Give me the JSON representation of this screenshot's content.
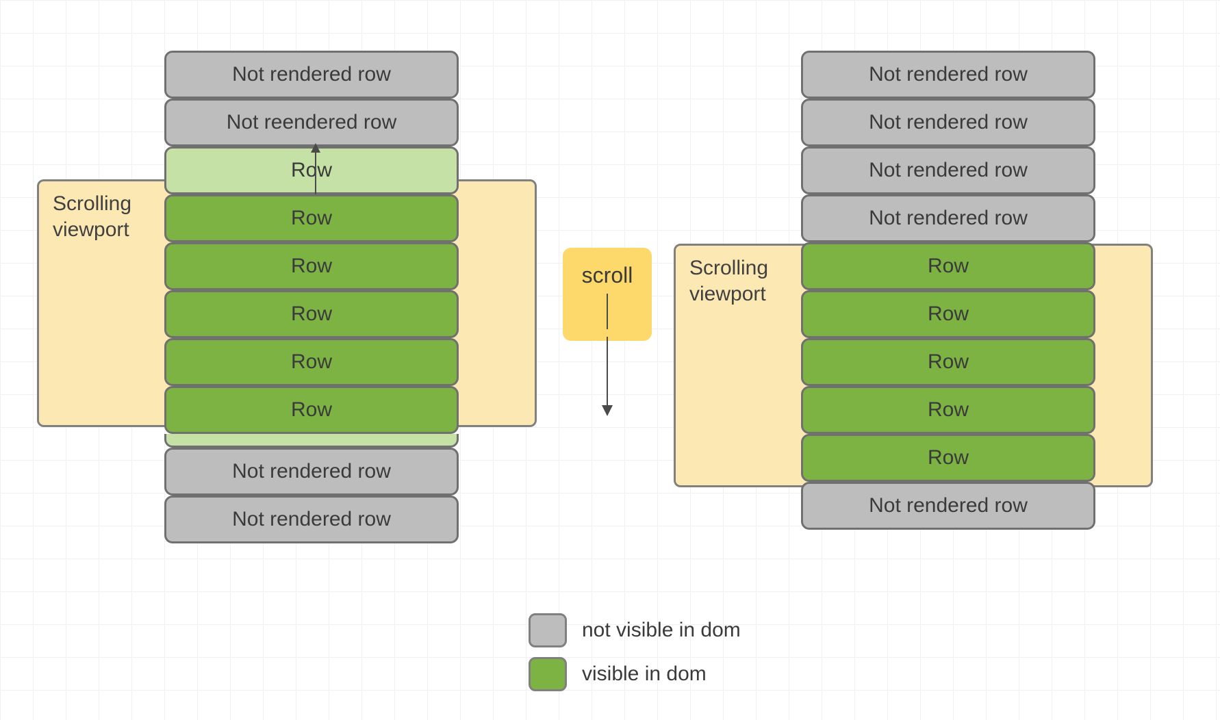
{
  "left": {
    "viewport_label": "Scrolling\nviewport",
    "rows": [
      {
        "label": "Not rendered row",
        "kind": "gray"
      },
      {
        "label": "Not reendered row",
        "kind": "gray"
      },
      {
        "label": "Row",
        "kind": "light"
      },
      {
        "label": "Row",
        "kind": "green"
      },
      {
        "label": "Row",
        "kind": "green"
      },
      {
        "label": "Row",
        "kind": "green"
      },
      {
        "label": "Row",
        "kind": "green"
      },
      {
        "label": "Row",
        "kind": "green"
      },
      {
        "label": "",
        "kind": "strip"
      },
      {
        "label": "Not rendered row",
        "kind": "gray"
      },
      {
        "label": "Not rendered row",
        "kind": "gray"
      }
    ]
  },
  "right": {
    "viewport_label": "Scrolling\nviewport",
    "rows": [
      {
        "label": "Not rendered row",
        "kind": "gray"
      },
      {
        "label": "Not rendered row",
        "kind": "gray"
      },
      {
        "label": "Not rendered row",
        "kind": "gray"
      },
      {
        "label": "Not rendered row",
        "kind": "gray"
      },
      {
        "label": "Row",
        "kind": "green"
      },
      {
        "label": "Row",
        "kind": "green"
      },
      {
        "label": "Row",
        "kind": "green"
      },
      {
        "label": "Row",
        "kind": "green"
      },
      {
        "label": "Row",
        "kind": "green"
      },
      {
        "label": "Not rendered row",
        "kind": "gray"
      }
    ]
  },
  "scroll_chip": {
    "label": "scroll"
  },
  "legend": {
    "not_visible": "not visible in dom",
    "visible": "visible in dom"
  }
}
